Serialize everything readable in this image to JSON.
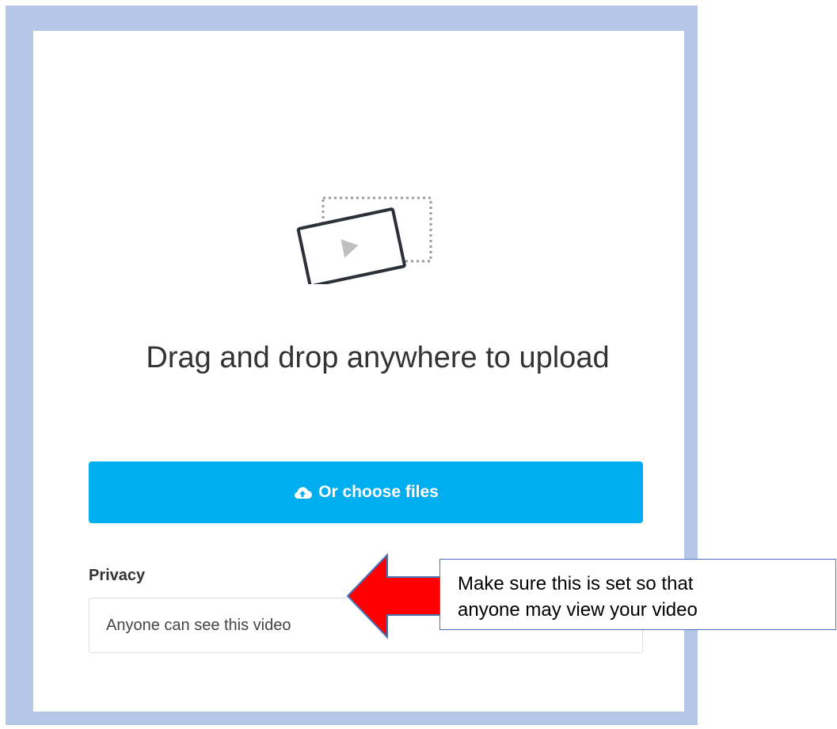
{
  "upload": {
    "title": "Drag and drop anywhere to upload",
    "button_label": "Or choose files",
    "button_color": "#00aeef"
  },
  "privacy": {
    "label": "Privacy",
    "selected_value": "Anyone can see this video"
  },
  "annotation": {
    "line1": "Make sure this is set so that",
    "line2": "anyone may view your video",
    "arrow_color": "#ff0000"
  },
  "icons": {
    "illustration": "video-frame-icon",
    "button_icon": "cloud-upload-icon"
  },
  "colors": {
    "frame": "#b5c7e6",
    "panel": "#ffffff"
  }
}
